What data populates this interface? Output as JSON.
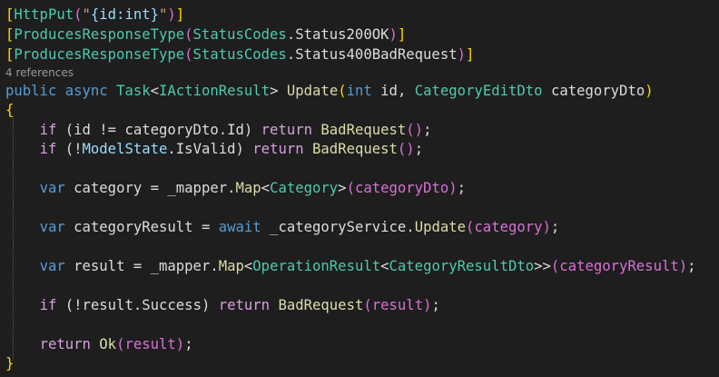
{
  "code": {
    "attr1": {
      "open": "[",
      "name": "HttpPut",
      "lparen": "(",
      "quote_open": "\"",
      "route": "{id:int}",
      "quote_close": "\"",
      "rparen": ")",
      "close": "]"
    },
    "attr2": {
      "open": "[",
      "name": "ProducesResponseType",
      "lparen": "(",
      "cls": "StatusCodes",
      "dot": ".",
      "member": "Status200OK",
      "rparen": ")",
      "close": "]"
    },
    "attr3": {
      "open": "[",
      "name": "ProducesResponseType",
      "lparen": "(",
      "cls": "StatusCodes",
      "dot": ".",
      "member": "Status400BadRequest",
      "rparen": ")",
      "close": "]"
    },
    "codelens": "4 references",
    "signature": {
      "kw_public": "public",
      "kw_async": "async",
      "task": "Task",
      "lt": "<",
      "iaction": "IActionResult",
      "gt": ">",
      "method": "Update",
      "lparen": "(",
      "kw_int": "int",
      "p1": " id, ",
      "ptype": "CategoryEditDto",
      "p2": " categoryDto",
      "rparen": ")"
    },
    "open_brace": "{",
    "if1": {
      "kw_if": "if",
      "a": " (id != categoryDto.",
      "member": "Id",
      "b": ") ",
      "kw_return": "return",
      "method": "BadRequest",
      "args": "()",
      "end": ";"
    },
    "if2": {
      "kw_if": "if",
      "a": " (!",
      "model": "ModelState",
      "dot": ".",
      "member": "IsValid",
      "b": ") ",
      "kw_return": "return",
      "method": "BadRequest",
      "args": "()",
      "end": ";"
    },
    "map1": {
      "kw_var": "var",
      "a": " category = _mapper.",
      "method": "Map",
      "lt": "<",
      "type": "Category",
      "gt": ">",
      "args": "(categoryDto)",
      "end": ";"
    },
    "await1": {
      "kw_var": "var",
      "a": " categoryResult = ",
      "kw_await": "await",
      "b": " _categoryService.",
      "method": "Update",
      "args": "(category)",
      "end": ";"
    },
    "map2": {
      "kw_var": "var",
      "a": " result = _mapper.",
      "method": "Map",
      "lt": "<",
      "type1": "OperationResult",
      "lt2": "<",
      "type2": "CategoryResultDto",
      "gt2": ">",
      "gt": ">",
      "args": "(categoryResult)",
      "end": ";"
    },
    "if3": {
      "kw_if": "if",
      "a": " (!result.",
      "member": "Success",
      "b": ") ",
      "kw_return": "return",
      "method": "BadRequest",
      "args": "(result)",
      "end": ";"
    },
    "ret": {
      "kw_return": "return",
      "method": "Ok",
      "args": "(result)",
      "end": ";"
    },
    "close_brace": "}"
  }
}
